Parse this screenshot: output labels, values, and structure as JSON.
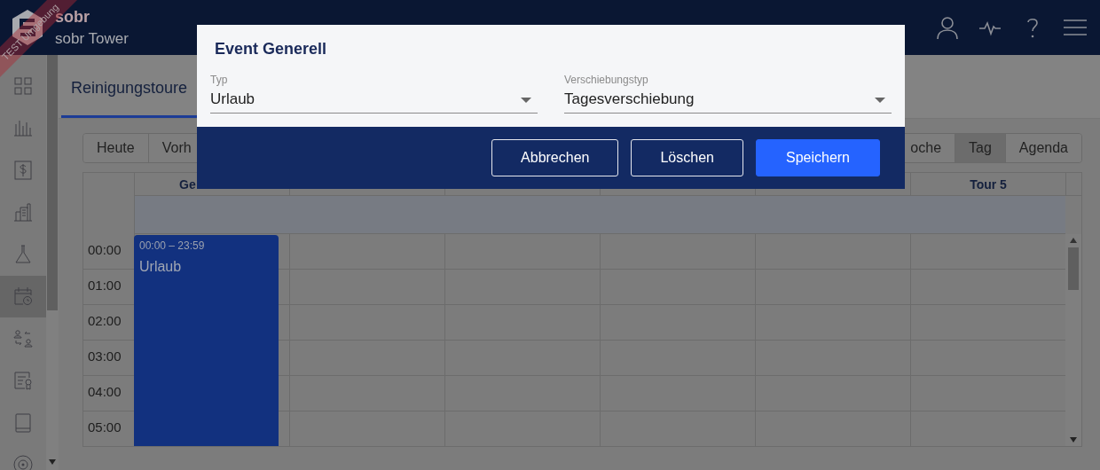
{
  "header": {
    "logo_text": "sobr",
    "subtitle": "sobr Tower",
    "environment_ribbon": "TEST Umgebung"
  },
  "sidebar": {
    "items": [
      {
        "kind": "grid",
        "selected": false
      },
      {
        "kind": "bars",
        "selected": false
      },
      {
        "kind": "dollar",
        "selected": false
      },
      {
        "kind": "buildings",
        "selected": false
      },
      {
        "kind": "flask",
        "selected": false
      },
      {
        "kind": "calendar",
        "selected": true
      },
      {
        "kind": "swap",
        "selected": false
      },
      {
        "kind": "certificate",
        "selected": false
      },
      {
        "kind": "tablet",
        "selected": false
      },
      {
        "kind": "target",
        "selected": false
      }
    ]
  },
  "tabs": [
    {
      "label": "Reinigungstoure",
      "selected": true
    }
  ],
  "toolbar": {
    "left": [
      {
        "label": "Heute",
        "selected": false
      },
      {
        "label": "Vorh",
        "selected": false
      }
    ],
    "right": [
      {
        "label": "oche",
        "selected": false
      },
      {
        "label": "Tag",
        "selected": true
      },
      {
        "label": "Agenda",
        "selected": false
      }
    ]
  },
  "calendar": {
    "first_column_head": "Ge",
    "last_column_head": "Tour 5",
    "times": [
      "00:00",
      "01:00",
      "02:00",
      "03:00",
      "04:00",
      "05:00"
    ],
    "events": [
      {
        "time": "00:00 – 23:59",
        "title": "Urlaub"
      }
    ]
  },
  "dialog": {
    "title": "Event Generell",
    "fields": [
      {
        "label": "Typ",
        "value": "Urlaub"
      },
      {
        "label": "Verschiebungstyp",
        "value": "Tagesverschiebung"
      }
    ],
    "buttons": [
      {
        "label": "Abbrechen",
        "kind": "outline"
      },
      {
        "label": "Löschen",
        "kind": "outline"
      },
      {
        "label": "Speichern",
        "kind": "primary"
      }
    ]
  }
}
